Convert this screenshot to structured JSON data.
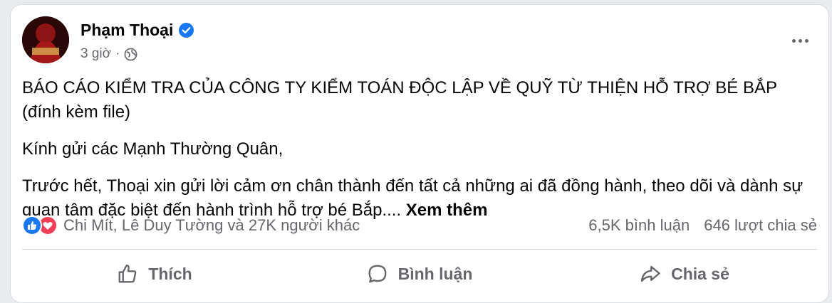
{
  "post": {
    "author": "Phạm Thoại",
    "time": "3 giờ",
    "separator": "·",
    "title": "BÁO CÁO KIỂM TRA CỦA CÔNG TY KIỂM TOÁN ĐỘC LẬP VỀ QUỸ TỪ THIỆN HỖ TRỢ BÉ BẮP (đính kèm file)",
    "greeting": "Kính gửi các Mạnh Thường Quân,",
    "paragraph": "Trước hết, Thoại xin gửi lời cảm ơn chân thành đến tất cả những ai đã đồng hành, theo dõi và dành sự quan tâm đặc biệt đến hành trình hỗ trợ bé Bắp....",
    "see_more": "Xem thêm"
  },
  "stats": {
    "reactions_text": "Chi Mít, Lê Duy Tường và 27K người khác",
    "comments": "6,5K bình luận",
    "shares": "646 lượt chia sẻ"
  },
  "actions": {
    "like": "Thích",
    "comment": "Bình luận",
    "share": "Chia sẻ"
  },
  "icons": {
    "verified": "verified-badge-icon",
    "privacy": "globe-icon",
    "more": "more-options-icon",
    "like_reaction": "like-reaction-icon",
    "love_reaction": "love-reaction-icon"
  },
  "colors": {
    "accent": "#1877f2",
    "love": "#f33e58",
    "secondary_text": "#65676b",
    "primary_text": "#050505"
  }
}
